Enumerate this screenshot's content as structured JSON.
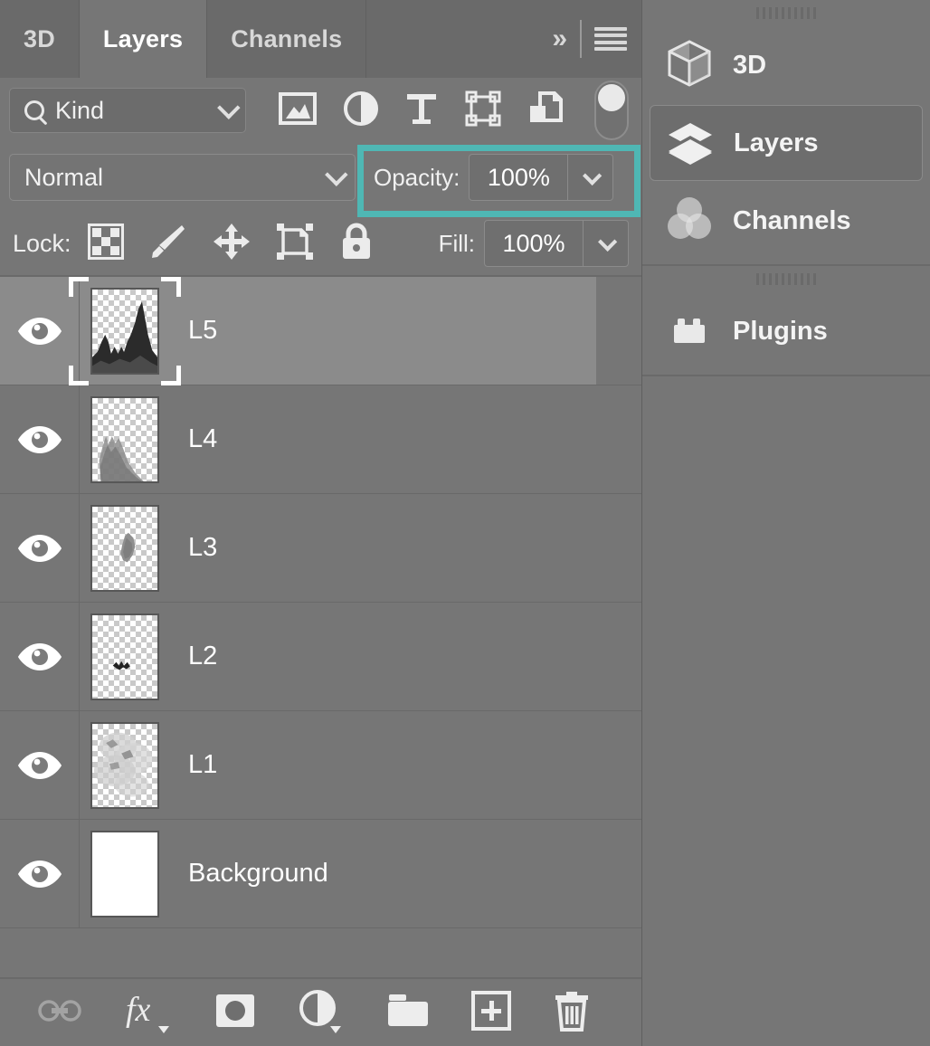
{
  "panel": {
    "tabs": [
      {
        "label": "3D",
        "active": false
      },
      {
        "label": "Layers",
        "active": true
      },
      {
        "label": "Channels",
        "active": false
      }
    ],
    "overflow_label": "»",
    "menu_icon": "hamburger-menu-icon"
  },
  "filter": {
    "kind_label": "Kind",
    "search_icon": "search-icon",
    "dropdown_icon": "chevron-down-icon",
    "type_filters": [
      {
        "name": "filter-pixel-layers",
        "icon": "image-icon"
      },
      {
        "name": "filter-adjustment-layers",
        "icon": "adjustment-half-circle-icon"
      },
      {
        "name": "filter-type-layers",
        "icon": "type-t-icon"
      },
      {
        "name": "filter-shape-layers",
        "icon": "shape-bounding-box-icon"
      },
      {
        "name": "filter-smart-objects",
        "icon": "smart-object-icon"
      }
    ],
    "toggle_name": "filter-enable-toggle"
  },
  "blend": {
    "mode": "Normal",
    "opacity_label": "Opacity:",
    "opacity_value": "100%",
    "fill_label": "Fill:",
    "fill_value": "100%"
  },
  "lock": {
    "label": "Lock:",
    "items": [
      {
        "name": "lock-transparent-pixels",
        "icon": "checkerboard-icon"
      },
      {
        "name": "lock-image-pixels",
        "icon": "brush-icon"
      },
      {
        "name": "lock-position",
        "icon": "move-arrows-icon"
      },
      {
        "name": "lock-artboard-nesting",
        "icon": "artboard-icon"
      },
      {
        "name": "lock-all",
        "icon": "padlock-icon"
      }
    ]
  },
  "highlight": {
    "target": "opacity-control",
    "color": "#4fb7b4"
  },
  "layers": [
    {
      "name": "L5",
      "visible": true,
      "selected": true,
      "thumb": "transparent-mountains"
    },
    {
      "name": "L4",
      "visible": true,
      "selected": false,
      "thumb": "transparent-shape-large"
    },
    {
      "name": "L3",
      "visible": true,
      "selected": false,
      "thumb": "transparent-shape-small"
    },
    {
      "name": "L2",
      "visible": true,
      "selected": false,
      "thumb": "transparent-bird"
    },
    {
      "name": "L1",
      "visible": true,
      "selected": false,
      "thumb": "transparent-clouds"
    },
    {
      "name": "Background",
      "visible": true,
      "selected": false,
      "thumb": "solid-white"
    }
  ],
  "bottom_toolbar": [
    {
      "name": "link-layers-button",
      "icon": "link-icon",
      "dimmed": true
    },
    {
      "name": "layer-style-button",
      "icon": "fx-icon",
      "dimmed": false
    },
    {
      "name": "add-layer-mask-button",
      "icon": "mask-icon",
      "dimmed": false
    },
    {
      "name": "new-adjustment-layer-button",
      "icon": "adjustment-half-circle-icon",
      "dimmed": false
    },
    {
      "name": "new-group-button",
      "icon": "folder-icon",
      "dimmed": false
    },
    {
      "name": "new-layer-button",
      "icon": "plus-square-icon",
      "dimmed": false
    },
    {
      "name": "delete-layer-button",
      "icon": "trash-icon",
      "dimmed": false
    }
  ],
  "sidebar": {
    "group1": [
      {
        "label": "3D",
        "icon": "cube-icon",
        "active": false
      },
      {
        "label": "Layers",
        "icon": "layers-stack-icon",
        "active": true
      },
      {
        "label": "Channels",
        "icon": "channels-circles-icon",
        "active": false
      }
    ],
    "group2": [
      {
        "label": "Plugins",
        "icon": "plugin-brick-icon",
        "active": false
      }
    ]
  }
}
